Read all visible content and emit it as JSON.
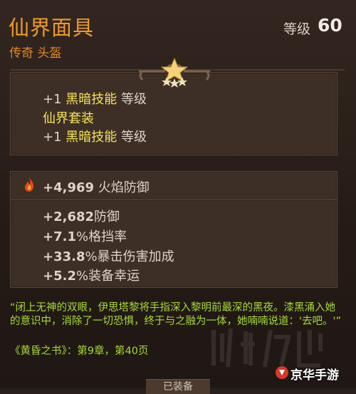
{
  "item": {
    "name": "仙界面具",
    "rarity_slot": "传奇 头盔",
    "level_label": "等级",
    "level_value": "60"
  },
  "set_bonus": {
    "line1_prefix": "+1",
    "line1_highlight": "黑暗技能",
    "line1_suffix": "等级",
    "set_name": "仙界套装",
    "line2_prefix": "+1",
    "line2_highlight": "黑暗技能",
    "line2_suffix": "等级"
  },
  "primary_stat": {
    "icon": "flame-icon",
    "value": "+4,969",
    "label": "火焰防御"
  },
  "stats": [
    {
      "value": "+2,682",
      "label": "防御"
    },
    {
      "value": "+7.1",
      "label": "%格挡率"
    },
    {
      "value": "+33.8",
      "label": "%暴击伤害加成"
    },
    {
      "value": "+5.2",
      "label": "%装备幸运"
    }
  ],
  "flavor": {
    "quote": "“闭上无神的双眼，伊思塔黎将手指深入黎明前最深的黑夜。漆黑涌入她的意识中，消除了一切恐惧，终于与之融为一体，她喃喃说道：'去吧。'”",
    "citation": "《黄昏之书》：第9章，第40页"
  },
  "footer": {
    "button_label": "已装备"
  },
  "watermark": {
    "site_name": "京华手游"
  },
  "colors": {
    "title": "#f09a2a",
    "highlight": "#f5e45c",
    "flavor": "#a9d83a"
  }
}
